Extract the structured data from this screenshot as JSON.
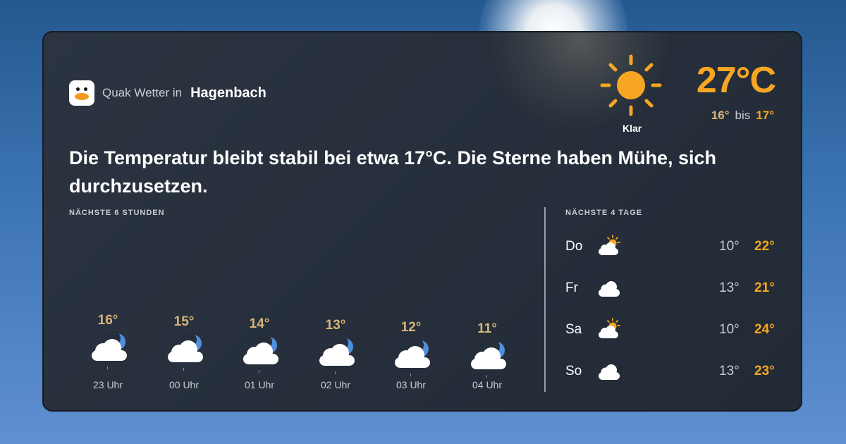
{
  "brand": {
    "label": "Quak Wetter in",
    "city": "Hagenbach"
  },
  "current": {
    "temperature": "27°C",
    "condition": "Klar",
    "icon": "sun-icon",
    "low": "16°",
    "range_word": "bis",
    "high": "17°"
  },
  "summary": "Die Temperatur bleibt stabil bei etwa 17°C. Die Sterne haben Mühe, sich durchzusetzen.",
  "hourly": {
    "title": "NÄCHSTE 6 STUNDEN",
    "items": [
      {
        "time": "23 Uhr",
        "temp": "16°",
        "value": 16,
        "icon": "cloud-moon-icon"
      },
      {
        "time": "00 Uhr",
        "temp": "15°",
        "value": 15,
        "icon": "cloud-moon-icon"
      },
      {
        "time": "01 Uhr",
        "temp": "14°",
        "value": 14,
        "icon": "cloud-moon-icon"
      },
      {
        "time": "02 Uhr",
        "temp": "13°",
        "value": 13,
        "icon": "cloud-moon-icon"
      },
      {
        "time": "03 Uhr",
        "temp": "12°",
        "value": 12,
        "icon": "cloud-moon-icon"
      },
      {
        "time": "04 Uhr",
        "temp": "11°",
        "value": 11,
        "icon": "cloud-moon-icon"
      }
    ]
  },
  "daily": {
    "title": "NÄCHSTE 4 TAGE",
    "items": [
      {
        "day": "Do",
        "low": "10°",
        "high": "22°",
        "icon": "cloud-sun-icon"
      },
      {
        "day": "Fr",
        "low": "13°",
        "high": "21°",
        "icon": "cloud-icon"
      },
      {
        "day": "Sa",
        "low": "10°",
        "high": "24°",
        "icon": "cloud-sun-icon"
      },
      {
        "day": "So",
        "low": "13°",
        "high": "23°",
        "icon": "cloud-icon"
      }
    ]
  },
  "colors": {
    "accent": "#f6a623",
    "muted_temp": "#d6b47c",
    "card_bg": "#252e3a",
    "moon": "#4f8fe0",
    "cloud": "#ffffff"
  }
}
